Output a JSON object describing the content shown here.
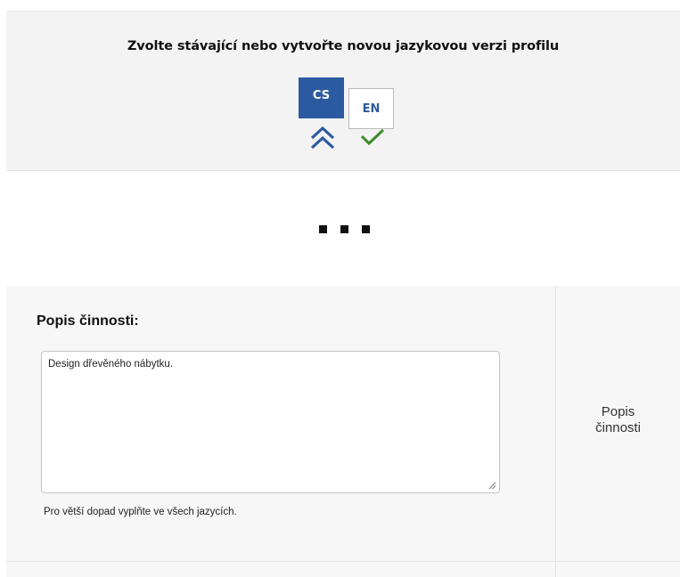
{
  "language_selector": {
    "title": "Zvolte stávající nebo vytvořte novou jazykovou verzi profilu",
    "languages": [
      {
        "code": "CS",
        "active": true,
        "marker": "double-chevron-up-icon"
      },
      {
        "code": "EN",
        "active": false,
        "marker": "checkmark-icon"
      }
    ],
    "colors": {
      "active_bg": "#2c5aa0",
      "chevron": "#2c5aa0",
      "check": "#3c8c2a"
    }
  },
  "divider": {
    "icon": "ellipsis-icon"
  },
  "description_field": {
    "label": "Popis činnosti:",
    "value": "Design dřevěného nábytku.",
    "hint": "Pro větší dopad vyplňte ve všech jazycích.",
    "side_label_line1": "Popis",
    "side_label_line2": "činnosti"
  }
}
